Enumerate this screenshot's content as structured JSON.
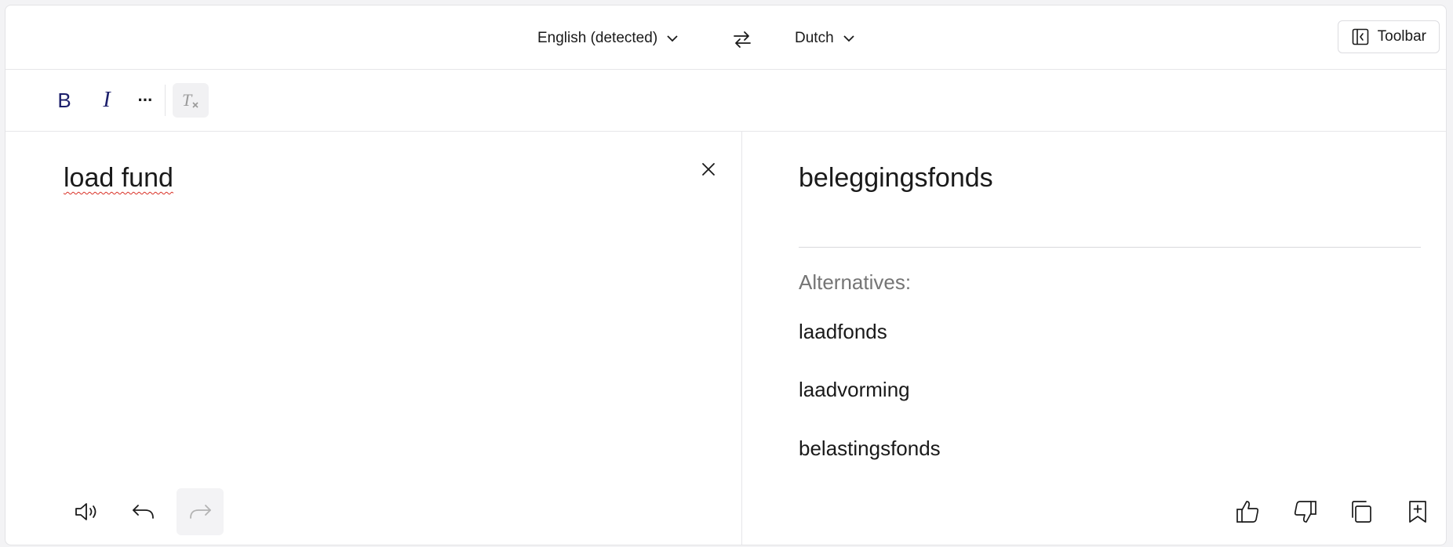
{
  "language_bar": {
    "source_language": "English (detected)",
    "target_language": "Dutch",
    "toolbar_label": "Toolbar"
  },
  "format_bar": {
    "bold_label": "B",
    "italic_label": "I",
    "more_label": "···"
  },
  "source": {
    "text": "load fund"
  },
  "target": {
    "translation": "beleggingsfonds",
    "alternatives_title": "Alternatives:",
    "alternatives": [
      "laadfonds",
      "laadvorming",
      "belastingsfonds"
    ]
  },
  "icons": {
    "swap": "swap-arrows-icon",
    "toolbar": "sidebar-collapse-icon",
    "clear_format": "clear-formatting-icon",
    "clear_text": "close-icon",
    "speaker": "speaker-icon",
    "undo": "undo-icon",
    "redo": "redo-icon",
    "thumbs_up": "thumbs-up-icon",
    "thumbs_down": "thumbs-down-icon",
    "copy": "copy-icon",
    "bookmark": "bookmark-add-icon"
  },
  "colors": {
    "accent_text": "#1c1f6b",
    "spellcheck": "#d93025"
  }
}
